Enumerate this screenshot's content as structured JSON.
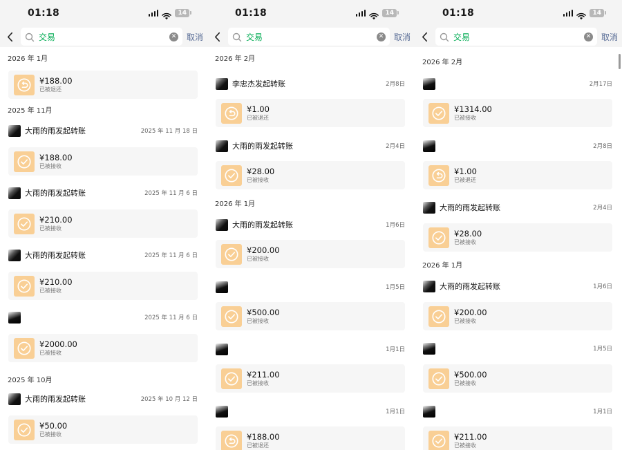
{
  "colors": {
    "accent": "#06ad56",
    "link": "#576b95",
    "ticket": "#f9cf95"
  },
  "panels": [
    {
      "status_time": "01:18",
      "battery": "14",
      "search_term": "交易",
      "cancel": "取消",
      "items": [
        {
          "type": "month",
          "text": "2026 年 1月"
        },
        {
          "type": "card",
          "amount": "¥188.00",
          "status": "已被退还",
          "icon": "return-icon"
        },
        {
          "type": "month",
          "text": "2025 年 11月"
        },
        {
          "type": "sender",
          "name": "大雨的雨发起转账",
          "date": "2025 年 11 月 18 日"
        },
        {
          "type": "card",
          "amount": "¥188.00",
          "status": "已被接收",
          "icon": "check-icon"
        },
        {
          "type": "sender",
          "name": "大雨的雨发起转账",
          "date": "2025 年 11 月 6 日"
        },
        {
          "type": "card",
          "amount": "¥210.00",
          "status": "已被接收",
          "icon": "check-icon"
        },
        {
          "type": "sender",
          "name": "大雨的雨发起转账",
          "date": "2025 年 11 月 6 日"
        },
        {
          "type": "card",
          "amount": "¥210.00",
          "status": "已被接收",
          "icon": "check-icon"
        },
        {
          "type": "sender",
          "name": "",
          "date": "2025 年 11 月 6 日"
        },
        {
          "type": "card",
          "amount": "¥2000.00",
          "status": "已被接收",
          "icon": "check-icon"
        },
        {
          "type": "month",
          "text": "2025 年 10月"
        },
        {
          "type": "sender",
          "name": "大雨的雨发起转账",
          "date": "2025 年 10 月 12 日"
        },
        {
          "type": "card",
          "amount": "¥50.00",
          "status": "已被接收",
          "icon": "check-icon"
        }
      ]
    },
    {
      "status_time": "01:18",
      "battery": "14",
      "search_term": "交易",
      "cancel": "取消",
      "items": [
        {
          "type": "month",
          "text": "2026 年 2月"
        },
        {
          "type": "sender",
          "name": "李忠杰发起转账",
          "date": "2月8日"
        },
        {
          "type": "card",
          "amount": "¥1.00",
          "status": "已被退还",
          "icon": "return-icon"
        },
        {
          "type": "sender",
          "name": "大雨的雨发起转账",
          "date": "2月4日"
        },
        {
          "type": "card",
          "amount": "¥28.00",
          "status": "已被接收",
          "icon": "check-icon"
        },
        {
          "type": "month",
          "text": "2026 年 1月"
        },
        {
          "type": "sender",
          "name": "大雨的雨发起转账",
          "date": "1月6日"
        },
        {
          "type": "card",
          "amount": "¥200.00",
          "status": "已被接收",
          "icon": "check-icon"
        },
        {
          "type": "sender",
          "name": "",
          "date": "1月5日"
        },
        {
          "type": "card",
          "amount": "¥500.00",
          "status": "已被接收",
          "icon": "check-icon"
        },
        {
          "type": "sender",
          "name": "",
          "date": "1月1日"
        },
        {
          "type": "card",
          "amount": "¥211.00",
          "status": "已被接收",
          "icon": "check-icon"
        },
        {
          "type": "sender",
          "name": "",
          "date": "1月1日"
        },
        {
          "type": "card",
          "amount": "¥188.00",
          "status": "已被退还",
          "icon": "return-icon"
        }
      ]
    },
    {
      "status_time": "01:18",
      "battery": "14",
      "search_term": "交易",
      "cancel": "取消",
      "items": [
        {
          "type": "month",
          "text": "2026 年 2月"
        },
        {
          "type": "sender",
          "name": "",
          "date": "2月17日"
        },
        {
          "type": "card",
          "amount": "¥1314.00",
          "status": "已被接收",
          "icon": "check-icon"
        },
        {
          "type": "sender",
          "name": "",
          "date": "2月8日"
        },
        {
          "type": "card",
          "amount": "¥1.00",
          "status": "已被退还",
          "icon": "return-icon"
        },
        {
          "type": "sender",
          "name": "大雨的雨发起转账",
          "date": "2月4日"
        },
        {
          "type": "card",
          "amount": "¥28.00",
          "status": "已被接收",
          "icon": "check-icon"
        },
        {
          "type": "month",
          "text": "2026 年 1月"
        },
        {
          "type": "sender",
          "name": "大雨的雨发起转账",
          "date": "1月6日"
        },
        {
          "type": "card",
          "amount": "¥200.00",
          "status": "已被接收",
          "icon": "check-icon"
        },
        {
          "type": "sender",
          "name": "",
          "date": "1月5日"
        },
        {
          "type": "card",
          "amount": "¥500.00",
          "status": "已被接收",
          "icon": "check-icon"
        },
        {
          "type": "sender",
          "name": "",
          "date": "1月1日"
        },
        {
          "type": "card",
          "amount": "¥211.00",
          "status": "已被接收",
          "icon": "check-icon"
        }
      ]
    }
  ]
}
